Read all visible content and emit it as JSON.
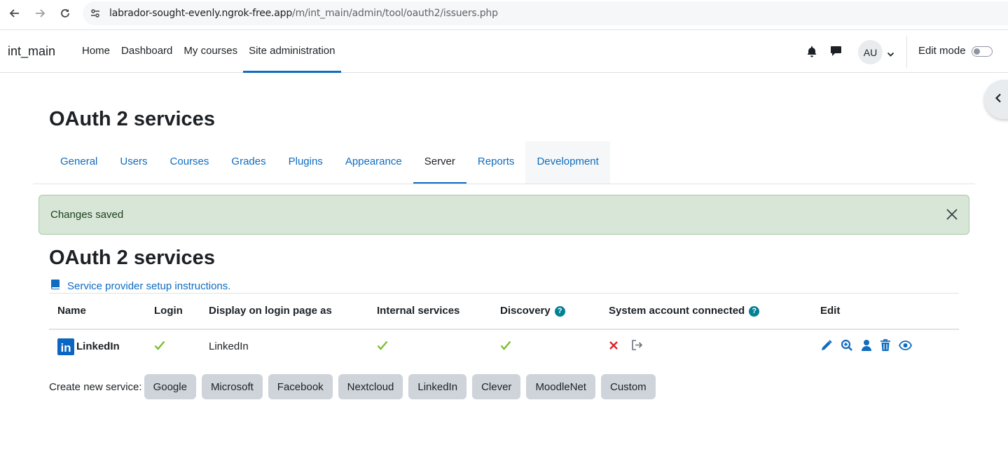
{
  "browser": {
    "url_host": "labrador-sought-evenly.ngrok-free.app",
    "url_path": "/m/int_main/admin/tool/oauth2/issuers.php"
  },
  "navbar": {
    "brand": "int_main",
    "items": [
      {
        "label": "Home",
        "active": false
      },
      {
        "label": "Dashboard",
        "active": false
      },
      {
        "label": "My courses",
        "active": false
      },
      {
        "label": "Site administration",
        "active": true
      }
    ],
    "avatar_initials": "AU",
    "edit_mode_label": "Edit mode"
  },
  "page": {
    "title": "OAuth 2 services",
    "tabs": [
      {
        "label": "General"
      },
      {
        "label": "Users"
      },
      {
        "label": "Courses"
      },
      {
        "label": "Grades"
      },
      {
        "label": "Plugins"
      },
      {
        "label": "Appearance"
      },
      {
        "label": "Server",
        "active": true
      },
      {
        "label": "Reports"
      },
      {
        "label": "Development"
      }
    ],
    "alert": "Changes saved",
    "heading": "OAuth 2 services",
    "setup_link": "Service provider setup instructions."
  },
  "table": {
    "headers": [
      "Name",
      "Login",
      "Display on login page as",
      "Internal services",
      "Discovery",
      "System account connected",
      "Edit"
    ],
    "help_icon": "?",
    "rows": [
      {
        "name": "LinkedIn",
        "logo_text": "in",
        "login": "check-icon",
        "display": "LinkedIn",
        "internal": "check-icon",
        "discovery": "check-icon",
        "system_account": "cross-icon"
      }
    ]
  },
  "create": {
    "label": "Create new service:",
    "buttons": [
      "Google",
      "Microsoft",
      "Facebook",
      "Nextcloud",
      "LinkedIn",
      "Clever",
      "MoodleNet",
      "Custom"
    ]
  },
  "colors": {
    "accent": "#0f6cbf",
    "success_bg": "#d7e6d7",
    "check": "#7ac034",
    "cross": "#e02424",
    "help": "#008196",
    "linkedin": "#0a66c2"
  }
}
